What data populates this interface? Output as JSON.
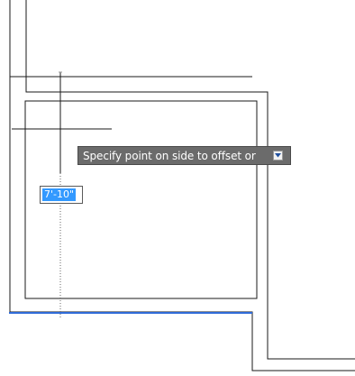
{
  "command_prompt": {
    "text": "Specify point on side to offset or",
    "options_icon": "chevron-down-icon"
  },
  "dynamic_input": {
    "value": "7'-10\""
  },
  "colors": {
    "drawing_lines": "#1a1a1a",
    "highlighted_line": "#2f6bd8",
    "input_highlight": "#3399ff",
    "tooltip_background": "#6b6b6b"
  }
}
